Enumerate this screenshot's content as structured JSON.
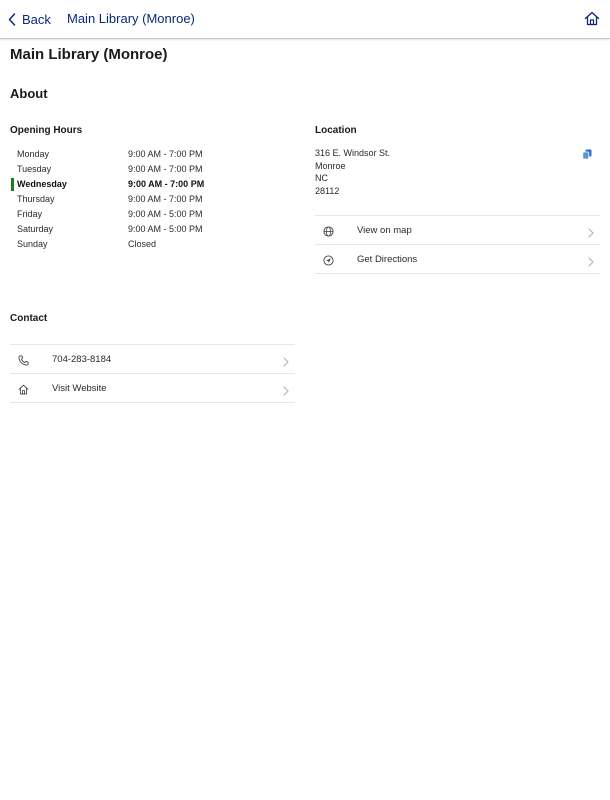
{
  "nav": {
    "back_label": "Back",
    "title": "Main Library (Monroe)",
    "home_icon": "home-icon",
    "accent_color": "#0a2a7a"
  },
  "page": {
    "title": "Main Library (Monroe)",
    "about_heading": "About"
  },
  "opening_hours": {
    "heading": "Opening Hours",
    "today_marker_color": "#1f7a1f",
    "rows": [
      {
        "day": "Monday",
        "time": "9:00 AM - 7:00 PM"
      },
      {
        "day": "Tuesday",
        "time": "9:00 AM - 7:00 PM"
      },
      {
        "day": "Wednesday",
        "time": "9:00 AM - 7:00 PM",
        "today": true
      },
      {
        "day": "Thursday",
        "time": "9:00 AM - 7:00 PM"
      },
      {
        "day": "Friday",
        "time": "9:00 AM - 5:00 PM"
      },
      {
        "day": "Saturday",
        "time": "9:00 AM - 5:00 PM"
      },
      {
        "day": "Sunday",
        "time": "Closed"
      }
    ]
  },
  "location": {
    "heading": "Location",
    "address_lines": [
      "316 E. Windsor St.",
      "Monroe",
      "NC",
      "28112"
    ],
    "copy_icon": "copy-icon",
    "links": [
      {
        "label": "View on map",
        "icon": "globe-icon"
      },
      {
        "label": "Get Directions",
        "icon": "directions-icon"
      }
    ]
  },
  "contact": {
    "heading": "Contact",
    "links": [
      {
        "label": "704-283-8184",
        "icon": "phone-icon"
      },
      {
        "label": "Visit Website",
        "icon": "home-icon"
      }
    ]
  }
}
